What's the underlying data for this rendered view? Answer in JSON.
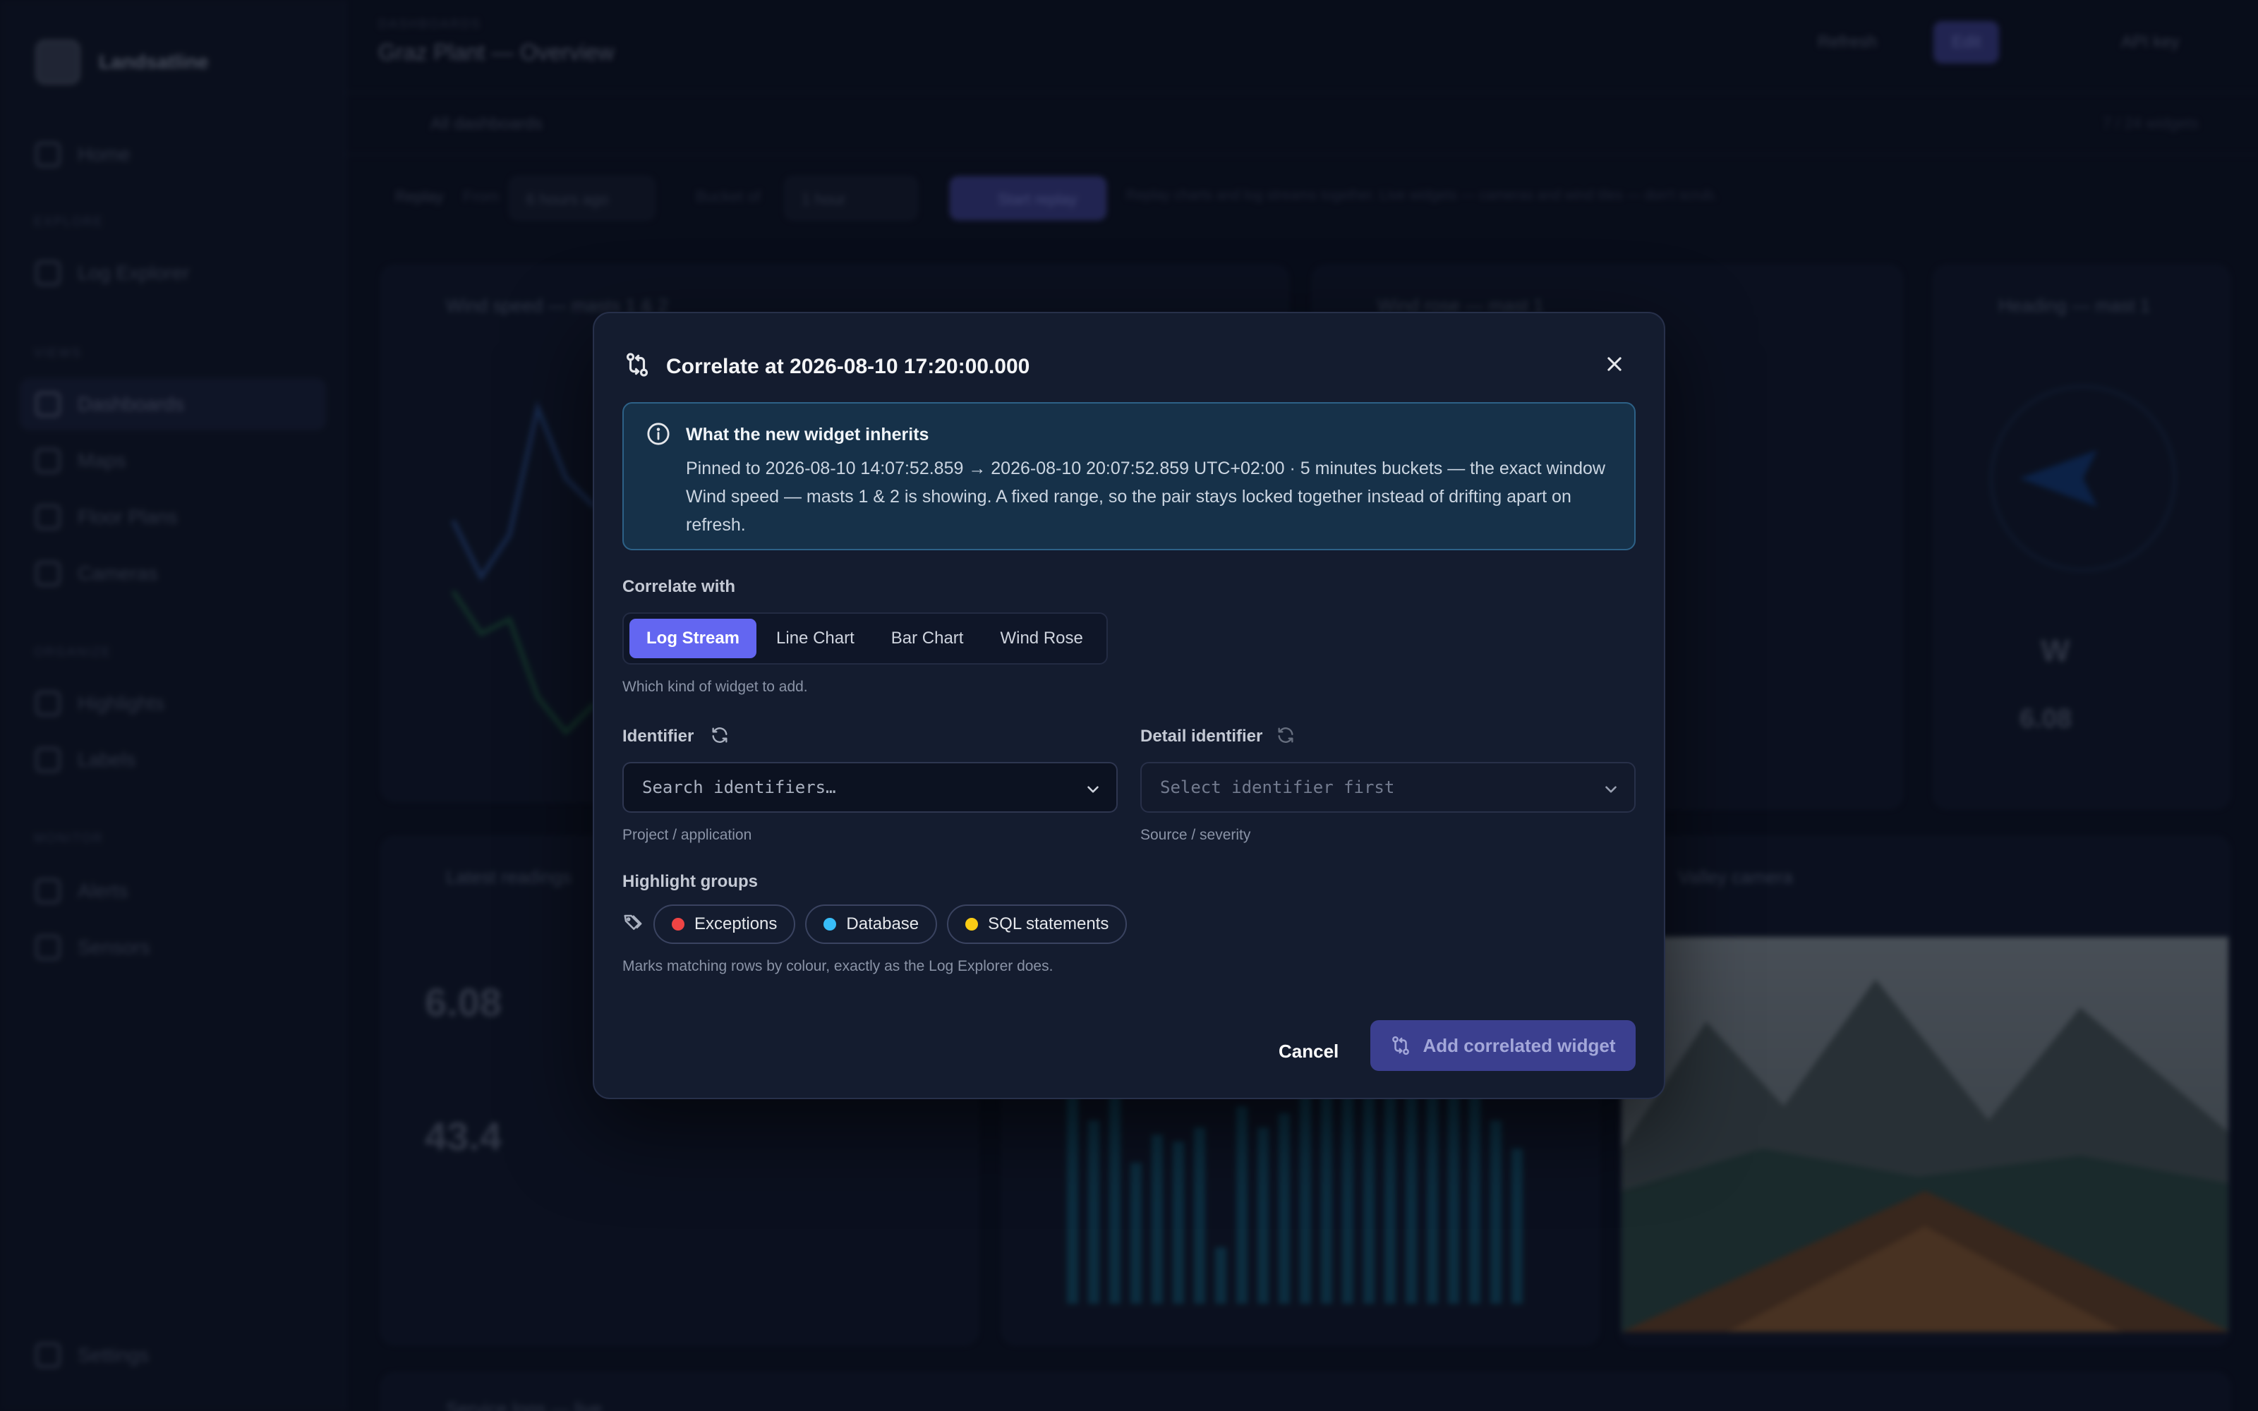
{
  "app": {
    "brand": "Landsatline",
    "crumb": "DASHBOARDS",
    "page_title": "Graz Plant — Overview",
    "back_link": "All dashboards",
    "widget_count": "7 / 24 widgets",
    "topbar": {
      "refresh": "Refresh",
      "edit": "Edit",
      "api_key": "API key"
    },
    "replay": {
      "label": "Replay",
      "from_label": "From",
      "from_value": "6 hours ago",
      "bucket_label": "Bucket of",
      "bucket_value": "1 hour",
      "start": "Start replay",
      "note": "Replay charts and log streams together. Live widgets — cameras and wind tiles — don't scrub."
    },
    "sidebar": {
      "home": "Home",
      "explore_section": "EXPLORE",
      "log_explorer": "Log Explorer",
      "views_section": "VIEWS",
      "dashboards": "Dashboards",
      "maps": "Maps",
      "floor_plans": "Floor Plans",
      "cameras": "Cameras",
      "organize_section": "ORGANIZE",
      "highlights": "Highlights",
      "labels": "Labels",
      "monitor_section": "MONITOR",
      "alerts": "Alerts",
      "sensors": "Sensors",
      "settings": "Settings"
    },
    "cards": {
      "wind_speed": "Wind speed — masts 1 & 2",
      "wind_rose": "Wind rose — mast 1",
      "heading": "Heading — mast 1",
      "latest": "Latest readings",
      "valley_camera": "Valley camera",
      "service_logs": "Service logs — live",
      "latest_value_1": "6.08",
      "latest_value_2": "43.4",
      "heading_dir": "W",
      "heading_value": "6.08"
    }
  },
  "modal": {
    "title": "Correlate at 2026-08-10 17:20:00.000",
    "info_title": "What the new widget inherits",
    "info_body": "Pinned to 2026-08-10 14:07:52.859 → 2026-08-10 20:07:52.859 UTC+02:00 · 5 minutes buckets — the exact window Wind speed — masts 1 & 2 is showing. A fixed range, so the pair stays locked together instead of drifting apart on refresh.",
    "correlate_label": "Correlate with",
    "widget_types": [
      "Log Stream",
      "Line Chart",
      "Bar Chart",
      "Wind Rose"
    ],
    "widget_hint": "Which kind of widget to add.",
    "identifier": {
      "label": "Identifier",
      "placeholder": "Search identifiers…",
      "hint": "Project / application"
    },
    "detail": {
      "label": "Detail identifier",
      "placeholder": "Select identifier first",
      "hint": "Source / severity"
    },
    "highlight_label": "Highlight groups",
    "highlights": [
      {
        "name": "Exceptions",
        "color": "#ef4444"
      },
      {
        "name": "Database",
        "color": "#38bdf8"
      },
      {
        "name": "SQL statements",
        "color": "#facc15"
      }
    ],
    "highlight_hint": "Marks matching rows by colour, exactly as the Log Explorer does.",
    "cancel": "Cancel",
    "submit": "Add correlated widget"
  }
}
